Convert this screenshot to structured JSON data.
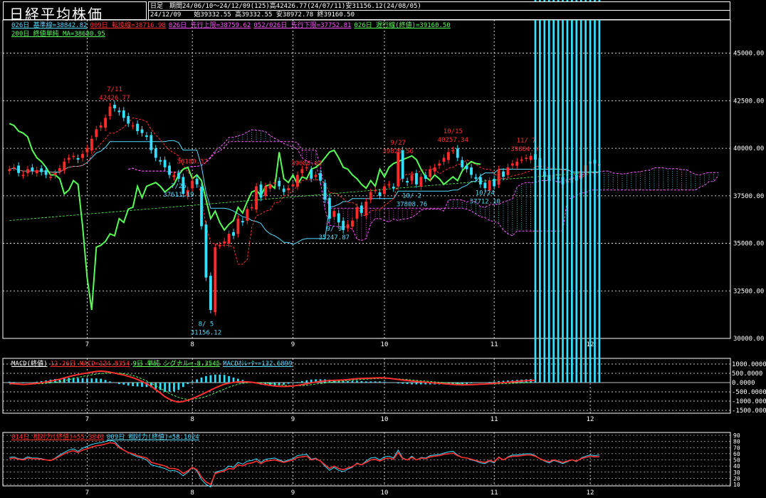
{
  "title": "日経平均株価",
  "header": {
    "line1": "日足　期間24/06/10～24/12/09(125)高42426.77(24/07/11)安31156.12(24/08/05)",
    "line2": "24/12/09　　始39332.55 高39332.55 安38972.78 終39160.50"
  },
  "legend_main": [
    {
      "text": "026日 基準線=38842.82",
      "color": "#55ddff"
    },
    {
      "text": "009日 転換線=38716.98",
      "color": "#ff3030"
    },
    {
      "text": "026日 先行上限=38759.62",
      "color": "#ff55ff"
    },
    {
      "text": "052/026日 先行下限=37752.81",
      "color": "#ff55ff"
    },
    {
      "text": "026日 遅行線(終値)=39160.50",
      "color": "#55ff55"
    }
  ],
  "legend_main2": {
    "text": "200日 終値単純 MA=38680.95",
    "color": "#55ff55"
  },
  "legend_macd": [
    {
      "text": "MACD(終値)",
      "color": "#ffffff"
    },
    {
      "text": "12-26日 MACD=124.8354",
      "color": "#ff3030"
    },
    {
      "text": "9日 単純 シグナル=-8.3545",
      "color": "#55ff55"
    },
    {
      "text": "MACDｵｼﾚｰﾀｰ=132.6899",
      "color": "#55ddff"
    }
  ],
  "legend_rsi": [
    {
      "text": "014日 相対力(終値)=55.3846",
      "color": "#ff3030"
    },
    {
      "text": "009日 相対力(終値)=58.1024",
      "color": "#55ddff"
    }
  ],
  "annotations": [
    {
      "text": "7/11",
      "day": 23,
      "price": 43000,
      "color": "#ff3030"
    },
    {
      "text": "42426.77",
      "day": 23,
      "price": 42550,
      "color": "#ff3030"
    },
    {
      "text": "38180.37",
      "day": 40,
      "price": 39200,
      "color": "#ff3030"
    },
    {
      "text": "7/26",
      "day": 37,
      "price": 37900,
      "color": "#55ddff"
    },
    {
      "text": "37611.19",
      "day": 37,
      "price": 37450,
      "color": "#55ddff"
    },
    {
      "text": "8/ 5",
      "day": 43,
      "price": 30650,
      "color": "#55ddff"
    },
    {
      "text": "31156.12",
      "day": 43,
      "price": 30200,
      "color": "#55ddff"
    },
    {
      "text": "39080.02",
      "day": 65,
      "price": 39100,
      "color": "#ff3030"
    },
    {
      "text": "9/ 9",
      "day": 71,
      "price": 35650,
      "color": "#55ddff"
    },
    {
      "text": "35247.87",
      "day": 71,
      "price": 35200,
      "color": "#55ddff"
    },
    {
      "text": "9/27",
      "day": 85,
      "price": 40200,
      "color": "#ff3030"
    },
    {
      "text": "39829.56",
      "day": 85,
      "price": 39750,
      "color": "#ff3030"
    },
    {
      "text": "10/ 2",
      "day": 88,
      "price": 37400,
      "color": "#55ddff"
    },
    {
      "text": "37808.76",
      "day": 88,
      "price": 36950,
      "color": "#55ddff"
    },
    {
      "text": "10/15",
      "day": 97,
      "price": 40800,
      "color": "#ff3030"
    },
    {
      "text": "40257.34",
      "day": 97,
      "price": 40350,
      "color": "#ff3030"
    },
    {
      "text": "10/24",
      "day": 104,
      "price": 37550,
      "color": "#55ddff"
    },
    {
      "text": "37712.10",
      "day": 104,
      "price": 37100,
      "color": "#55ddff"
    },
    {
      "text": "11/ 7",
      "day": 113,
      "price": 40300,
      "color": "#ff3030"
    },
    {
      "text": "39884.01",
      "day": 113,
      "price": 39850,
      "color": "#ff3030"
    }
  ],
  "chart_data": [
    {
      "type": "candlestick",
      "name": "日経平均株価",
      "x_tick_labels": [
        "7",
        "8",
        "9",
        "10",
        "11",
        "12"
      ],
      "x_tick_days": [
        17,
        40,
        62,
        82,
        106,
        127
      ],
      "ylim": [
        30000,
        46000
      ],
      "y_ticks": [
        30000,
        32500,
        35000,
        37500,
        40000,
        42500,
        45000
      ],
      "y_tick_labels": [
        "30000.00",
        "32500.00",
        "35000.00",
        "37500.00",
        "40000.00",
        "42500.00",
        "45000.00"
      ],
      "grid": true,
      "close": [
        38900,
        39000,
        38700,
        38600,
        38900,
        38800,
        38850,
        38750,
        38600,
        38500,
        38700,
        38950,
        39300,
        39500,
        39600,
        39400,
        39700,
        40000,
        40500,
        41000,
        41200,
        41600,
        42200,
        42100,
        41900,
        41600,
        41300,
        41200,
        40900,
        40800,
        40600,
        39900,
        39500,
        39300,
        39000,
        38600,
        38600,
        38400,
        37600,
        37800,
        38300,
        38100,
        35900,
        33200,
        31500,
        34800,
        34900,
        35100,
        35500,
        35400,
        36300,
        36100,
        36800,
        36900,
        38000,
        37400,
        38000,
        38100,
        38200,
        38000,
        37700,
        37900,
        38100,
        38600,
        38900,
        39000,
        38400,
        38600,
        38300,
        37300,
        36300,
        36700,
        36100,
        35700,
        36000,
        36200,
        36900,
        36600,
        37200,
        37700,
        37800,
        37500,
        38000,
        38100,
        37900,
        39800,
        38400,
        38200,
        38600,
        38100,
        38500,
        38400,
        38900,
        39000,
        39200,
        39500,
        39800,
        39900,
        39500,
        39000,
        38900,
        38600,
        38400,
        38100,
        37900,
        38300,
        38000,
        38900,
        38500,
        39000,
        39200,
        39300,
        39400,
        39500,
        39600,
        39400,
        38900,
        38500,
        38300,
        38600,
        38400,
        38100,
        38300,
        38500,
        38300,
        38800,
        39100,
        39300,
        39200,
        39160
      ]
    },
    {
      "type": "line",
      "name": "MACD",
      "ylim": [
        -1500,
        1000
      ],
      "y_ticks": [
        1000,
        500,
        0,
        -500,
        -1000,
        -1500
      ],
      "y_tick_labels": [
        "1000.0000",
        "500.0000",
        "0.0000",
        "-500.0000",
        "-1000.0000",
        "-1500.0000"
      ],
      "series": [
        {
          "name": "12-26日 MACD",
          "values": [
            -50,
            -60,
            -80,
            -100,
            -90,
            -70,
            -40,
            -10,
            30,
            80,
            130,
            180,
            250,
            320,
            380,
            430,
            480,
            520,
            560,
            600,
            620,
            600,
            560,
            510,
            460,
            410,
            340,
            260,
            170,
            60,
            -60,
            -200,
            -380,
            -560,
            -760,
            -900,
            -1000,
            -1050,
            -1020,
            -950,
            -860,
            -760,
            -650,
            -530,
            -410,
            -290,
            -180,
            -90,
            -30,
            10,
            40,
            50,
            40,
            20,
            -20,
            -70,
            -110,
            -150,
            -180,
            -200,
            -210,
            -200,
            -180,
            -150,
            -110,
            -60,
            -10,
            30,
            60,
            90,
            110,
            120,
            130,
            140,
            160,
            190,
            210,
            220,
            230,
            240,
            250,
            260,
            250,
            230,
            200,
            170,
            140,
            110,
            80,
            60,
            40,
            20,
            0,
            -20,
            -40,
            -60,
            -80,
            -100,
            -110,
            -120,
            -120,
            -110,
            -100,
            -90,
            -80,
            -60,
            -40,
            -20,
            0,
            20,
            40,
            60,
            80,
            100,
            110,
            124.8354
          ]
        },
        {
          "name": "9日 単純 シグナル",
          "values": [
            -80,
            -80,
            -80,
            -80,
            -80,
            -80,
            -70,
            -60,
            -40,
            -20,
            10,
            50,
            100,
            160,
            220,
            280,
            330,
            380,
            420,
            460,
            490,
            510,
            520,
            520,
            510,
            480,
            440,
            380,
            300,
            200,
            90,
            -40,
            -170,
            -310,
            -450,
            -590,
            -700,
            -800,
            -870,
            -900,
            -900,
            -870,
            -820,
            -750,
            -660,
            -560,
            -450,
            -350,
            -250,
            -160,
            -90,
            -40,
            -10,
            5,
            10,
            0,
            -20,
            -50,
            -80,
            -110,
            -140,
            -160,
            -170,
            -170,
            -160,
            -140,
            -110,
            -80,
            -50,
            -20,
            10,
            40,
            70,
            90,
            110,
            130,
            150,
            170,
            190,
            200,
            210,
            220,
            220,
            220,
            210,
            200,
            180,
            160,
            140,
            120,
            100,
            80,
            60,
            40,
            20,
            0,
            -20,
            -40,
            -55,
            -70,
            -80,
            -85,
            -90,
            -90,
            -85,
            -80,
            -75,
            -70,
            -60,
            -50,
            -40,
            -30,
            -20,
            -10,
            -8.3545
          ]
        }
      ]
    },
    {
      "type": "line",
      "name": "相対力",
      "ylim": [
        10,
        90
      ],
      "y_ticks": [
        90,
        80,
        70,
        60,
        50,
        40,
        30,
        20,
        10
      ],
      "y_tick_labels": [
        "90",
        "80",
        "70",
        "60",
        "50",
        "40",
        "30",
        "20",
        "10"
      ],
      "series": [
        {
          "name": "014日 相対力(終値)",
          "values": [
            52,
            53,
            51,
            50,
            53,
            52,
            52,
            51,
            50,
            49,
            52,
            56,
            60,
            63,
            65,
            62,
            66,
            68,
            71,
            73,
            74,
            76,
            78,
            77,
            70,
            66,
            62,
            60,
            57,
            55,
            53,
            46,
            44,
            42,
            40,
            36,
            36,
            34,
            28,
            32,
            38,
            34,
            22,
            14,
            10,
            28,
            30,
            32,
            36,
            35,
            42,
            40,
            44,
            45,
            48,
            44,
            48,
            49,
            50,
            48,
            46,
            48,
            50,
            54,
            55,
            56,
            50,
            52,
            48,
            42,
            36,
            40,
            36,
            34,
            37,
            39,
            44,
            42,
            46,
            50,
            51,
            48,
            52,
            53,
            51,
            62,
            52,
            50,
            54,
            50,
            53,
            52,
            55,
            56,
            57,
            59,
            60,
            61,
            57,
            54,
            53,
            51,
            49,
            47,
            46,
            49,
            47,
            54,
            50,
            54,
            56,
            56,
            57,
            58,
            58,
            56,
            52,
            49,
            47,
            50,
            48,
            46,
            48,
            50,
            48,
            52,
            54,
            56,
            55,
            55.3846
          ]
        },
        {
          "name": "009日 相対力(終値)",
          "values": [
            54,
            55,
            52,
            51,
            55,
            53,
            53,
            52,
            50,
            49,
            53,
            58,
            62,
            66,
            68,
            64,
            69,
            72,
            75,
            77,
            78,
            80,
            82,
            80,
            72,
            66,
            62,
            58,
            55,
            53,
            50,
            42,
            40,
            38,
            36,
            32,
            33,
            30,
            24,
            30,
            38,
            32,
            18,
            10,
            6,
            30,
            32,
            34,
            40,
            38,
            46,
            43,
            48,
            49,
            52,
            46,
            51,
            52,
            53,
            50,
            47,
            50,
            52,
            57,
            58,
            59,
            51,
            53,
            48,
            40,
            33,
            38,
            33,
            31,
            35,
            38,
            45,
            42,
            48,
            53,
            54,
            50,
            55,
            56,
            53,
            66,
            53,
            50,
            56,
            50,
            54,
            53,
            57,
            58,
            59,
            61,
            63,
            64,
            58,
            54,
            53,
            50,
            48,
            45,
            44,
            48,
            45,
            55,
            50,
            55,
            58,
            58,
            59,
            60,
            60,
            57,
            52,
            48,
            45,
            49,
            47,
            44,
            47,
            50,
            47,
            53,
            56,
            58,
            57,
            58.1024
          ]
        }
      ]
    }
  ]
}
